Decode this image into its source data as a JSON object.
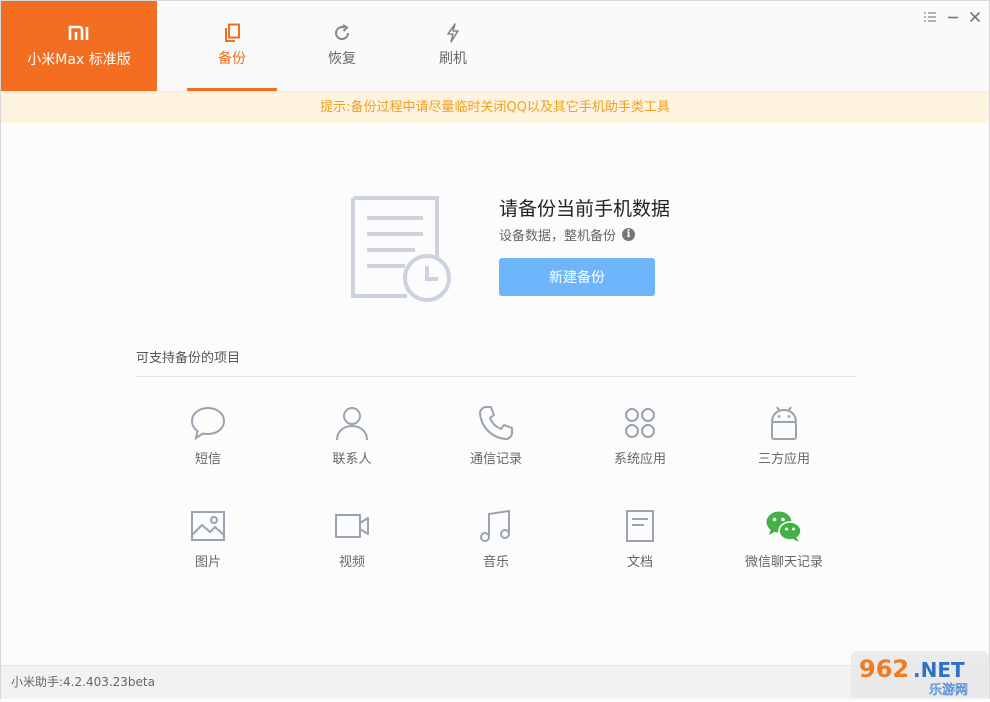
{
  "brand": {
    "logo_text": "MI",
    "model": "小米Max 标准版",
    "color": "#f36e21"
  },
  "tabs": [
    {
      "label": "备份",
      "icon": "copy-icon",
      "active": true
    },
    {
      "label": "恢复",
      "icon": "refresh-icon",
      "active": false
    },
    {
      "label": "刷机",
      "icon": "lightning-icon",
      "active": false
    }
  ],
  "window_controls": [
    "menu-icon",
    "minimize-icon",
    "close-icon"
  ],
  "notice": "提示:备份过程中请尽量临时关闭QQ以及其它手机助手类工具",
  "hero": {
    "title": "请备份当前手机数据",
    "subtitle": "设备数据，整机备份",
    "button_label": "新建备份",
    "button_color": "#6db6fb"
  },
  "supported": {
    "title": "可支持备份的项目",
    "items": [
      {
        "label": "短信",
        "icon": "sms-icon"
      },
      {
        "label": "联系人",
        "icon": "contact-icon"
      },
      {
        "label": "通信记录",
        "icon": "phone-icon"
      },
      {
        "label": "系统应用",
        "icon": "apps-grid-icon"
      },
      {
        "label": "三方应用",
        "icon": "android-icon"
      },
      {
        "label": "图片",
        "icon": "image-icon"
      },
      {
        "label": "视频",
        "icon": "video-icon"
      },
      {
        "label": "音乐",
        "icon": "music-icon"
      },
      {
        "label": "文档",
        "icon": "document-icon"
      },
      {
        "label": "微信聊天记录",
        "icon": "wechat-icon"
      }
    ]
  },
  "footer": {
    "version": "小米助手:4.2.403.23beta"
  },
  "watermark": {
    "text": "962.NET",
    "subtext": "乐游网"
  }
}
